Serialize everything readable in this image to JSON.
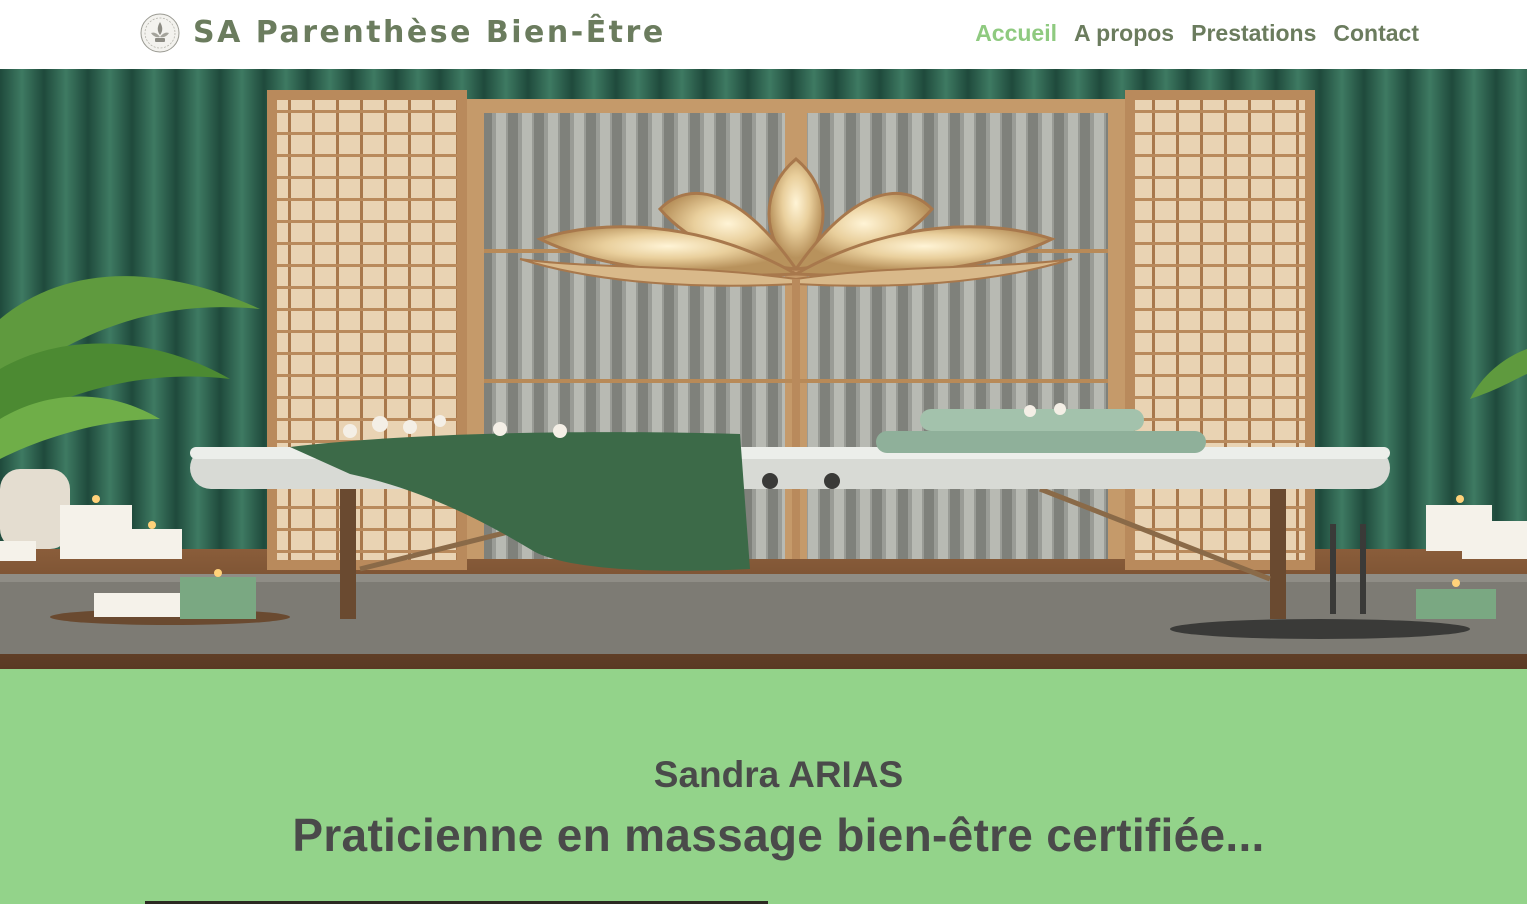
{
  "header": {
    "site_title": "SA Parenthèse Bien-Être",
    "logo_icon": "lotus-seal-logo-icon"
  },
  "nav": {
    "items": [
      {
        "label": "Accueil",
        "active": true
      },
      {
        "label": "A propos",
        "active": false
      },
      {
        "label": "Prestations",
        "active": false
      },
      {
        "label": "Contact",
        "active": false
      }
    ],
    "active_color": "#8fca80",
    "color": "#6b7c5e"
  },
  "hero": {
    "image": "massage-room-hero-image"
  },
  "intro": {
    "name": "Sandra ARIAS",
    "tagline": "Praticienne en massage bien-être certifiée...",
    "background": "#93d38a",
    "text_color": "#4a4a4a"
  }
}
